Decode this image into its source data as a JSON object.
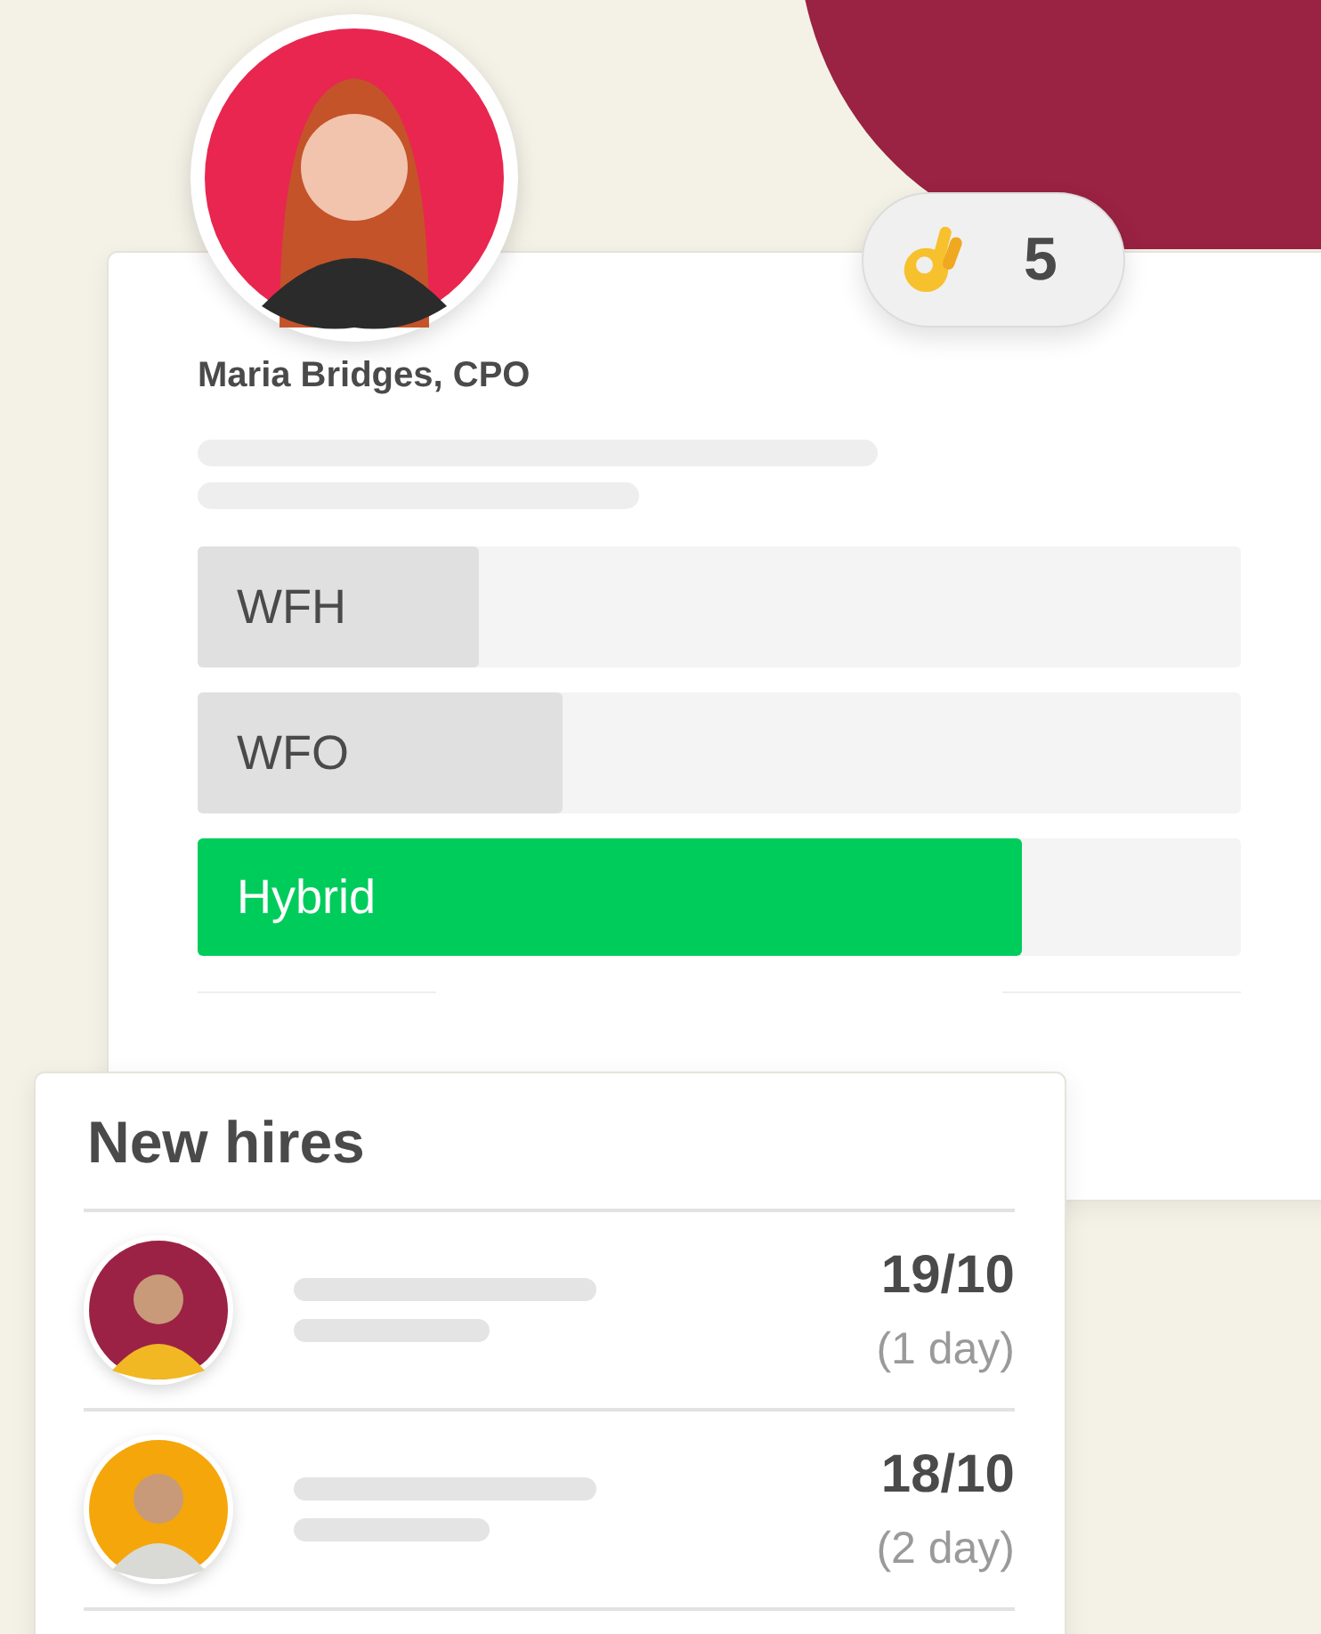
{
  "profile": {
    "name": "Maria Bridges, CPO"
  },
  "reaction": {
    "count": "5"
  },
  "poll": {
    "options": [
      {
        "label": "WFH",
        "level": 0.27,
        "selected": false
      },
      {
        "label": "WFO",
        "level": 0.35,
        "selected": false
      },
      {
        "label": "Hybrid",
        "level": 0.79,
        "selected": true
      }
    ]
  },
  "new_hires": {
    "title": "New hires",
    "rows": [
      {
        "date": "19/10",
        "ago": "(1 day)"
      },
      {
        "date": "18/10",
        "ago": "(2 day)"
      }
    ]
  }
}
